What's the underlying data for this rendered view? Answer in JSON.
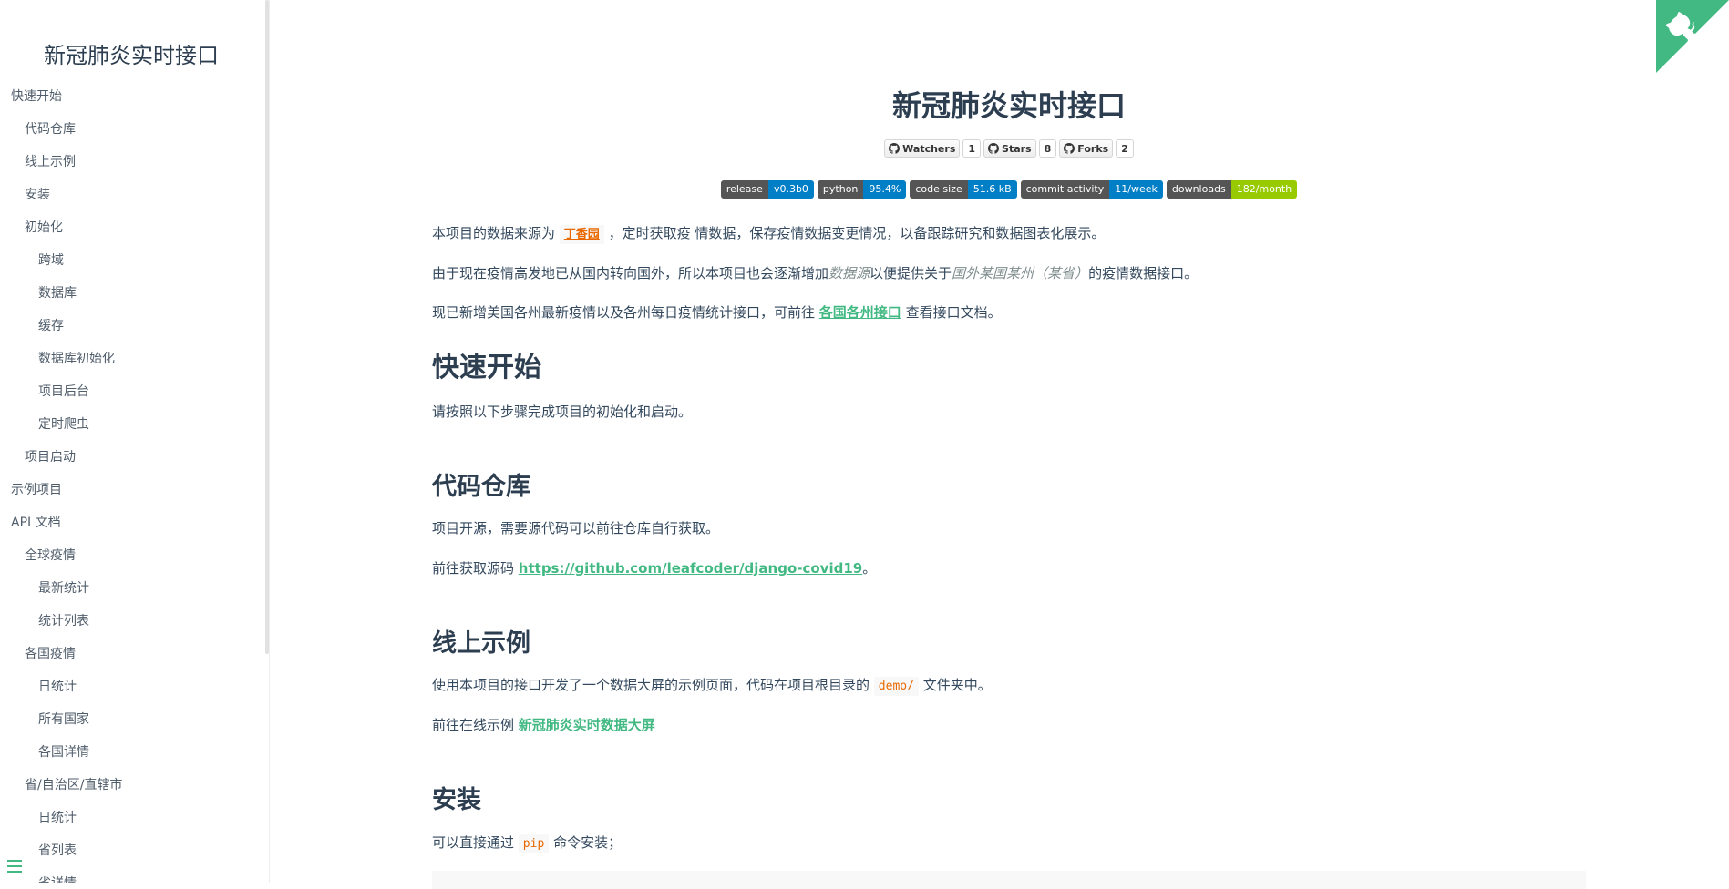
{
  "sidebar": {
    "title": "新冠肺炎实时接口",
    "items": [
      {
        "label": "快速开始",
        "level": 0
      },
      {
        "label": "代码仓库",
        "level": 1
      },
      {
        "label": "线上示例",
        "level": 1
      },
      {
        "label": "安装",
        "level": 1
      },
      {
        "label": "初始化",
        "level": 1
      },
      {
        "label": "跨域",
        "level": 2
      },
      {
        "label": "数据库",
        "level": 2
      },
      {
        "label": "缓存",
        "level": 2
      },
      {
        "label": "数据库初始化",
        "level": 2
      },
      {
        "label": "项目后台",
        "level": 2
      },
      {
        "label": "定时爬虫",
        "level": 2
      },
      {
        "label": "项目启动",
        "level": 1
      },
      {
        "label": "示例项目",
        "level": 0
      },
      {
        "label": "API 文档",
        "level": 0
      },
      {
        "label": "全球疫情",
        "level": 1
      },
      {
        "label": "最新统计",
        "level": 2
      },
      {
        "label": "统计列表",
        "level": 2
      },
      {
        "label": "各国疫情",
        "level": 1
      },
      {
        "label": "日统计",
        "level": 2
      },
      {
        "label": "所有国家",
        "level": 2
      },
      {
        "label": "各国详情",
        "level": 2
      },
      {
        "label": "省/自治区/直辖市",
        "level": 1
      },
      {
        "label": "日统计",
        "level": 2
      },
      {
        "label": "省列表",
        "level": 2
      },
      {
        "label": "省详情",
        "level": 2
      }
    ]
  },
  "page": {
    "title": "新冠肺炎实时接口",
    "github_buttons": [
      {
        "label": "Watchers",
        "count": "1"
      },
      {
        "label": "Stars",
        "count": "8"
      },
      {
        "label": "Forks",
        "count": "2"
      }
    ],
    "shields": [
      {
        "left": "release",
        "right": "v0.3b0",
        "color": "#007ec6"
      },
      {
        "left": "python",
        "right": "95.4%",
        "color": "#007ec6"
      },
      {
        "left": "code size",
        "right": "51.6 kB",
        "color": "#007ec6"
      },
      {
        "left": "commit activity",
        "right": "11/week",
        "color": "#007ec6"
      },
      {
        "left": "downloads",
        "right": "182/month",
        "color": "#97ca00"
      }
    ],
    "intro1_pre": "本项目的数据来源为",
    "intro1_link": "丁香园",
    "intro1_post": "，定时获取疫 情数据，保存疫情数据变更情况，以备跟踪研究和数据图表化展示。",
    "intro2_pre": "由于现在疫情高发地已从国内转向国外，所以本项目也会逐渐增加",
    "intro2_em1": "数据源",
    "intro2_mid": "以便提供关于",
    "intro2_em2": "国外某国某州（某省）",
    "intro2_post": "的疫情数据接口。",
    "intro3_pre": "现已新增美国各州最新疫情以及各州每日疫情统计接口，可前往",
    "intro3_link": "各国各州接口",
    "intro3_post": "查看接口文档。",
    "quickstart_heading": "快速开始",
    "quickstart_text": "请按照以下步骤完成项目的初始化和启动。",
    "repo_heading": "代码仓库",
    "repo_text": "项目开源，需要源代码可以前往仓库自行获取。",
    "repo_link_pre": "前往获取源码",
    "repo_link": "https://github.com/leafcoder/django-covid19",
    "repo_link_post": "。",
    "demo_heading": "线上示例",
    "demo_text_pre": "使用本项目的接口开发了一个数据大屏的示例页面，代码在项目根目录的",
    "demo_code": "demo/",
    "demo_text_post": "文件夹中。",
    "demo_link_pre": "前往在线示例",
    "demo_link": "新冠肺炎实时数据大屏",
    "install_heading": "安装",
    "install_text_pre": "可以直接通过",
    "install_code": "pip",
    "install_text_post": "命令安装；"
  },
  "colors": {
    "accent": "#42b983",
    "heading": "#2c3e50",
    "text": "#34495e",
    "code": "#e96900"
  }
}
